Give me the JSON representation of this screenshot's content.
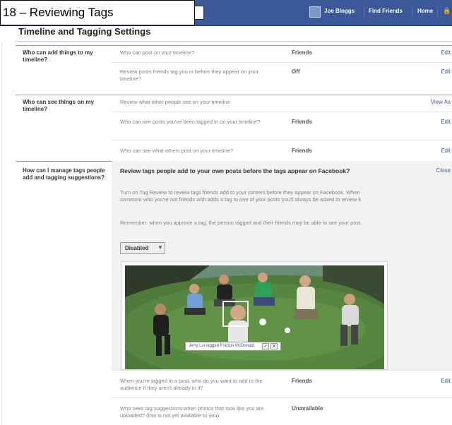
{
  "slide": {
    "title": "18 – Reviewing Tags"
  },
  "topbar": {
    "user_name": "Joe Bloggs",
    "nav_find_friends": "Find Friends",
    "nav_home": "Home",
    "bar_color": "#3b5998"
  },
  "page": {
    "heading": "Timeline and Tagging Settings"
  },
  "sections": {
    "add_things": {
      "label": "Who can add things to my timeline?",
      "rows": [
        {
          "question": "Who can post on your timeline?",
          "value": "Friends",
          "action": "Edit"
        },
        {
          "question": "Review posts friends tag you in before they appear on your timeline?",
          "value": "Off",
          "action": "Edit"
        }
      ]
    },
    "see_things": {
      "label": "Who can see things on my timeline?",
      "rows": [
        {
          "question": "Review what other people see on your timeline",
          "value": "",
          "action": "View As"
        },
        {
          "question": "Who can see posts you've been tagged in on your timeline?",
          "value": "Friends",
          "action": "Edit"
        },
        {
          "question": "Who can see what others post on your timeline?",
          "value": "Friends",
          "action": "Edit"
        }
      ]
    },
    "manage_tags": {
      "label": "How can I manage tags people add and tagging suggestions?",
      "review": {
        "title": "Review tags people add to your own posts before the tags appear on Facebook?",
        "close": "Close",
        "description": "Turn on Tag Review to review tags friends add to your content before they appear on Facebook. When someone who you're not friends with adds a tag to one of your posts you'll always be asked to review it.",
        "remember": "Remember: when you approve a tag, the person tagged and their friends may be able to see your post.",
        "dropdown_value": "Disabled",
        "tag_popup": {
          "tagger": "Jerry Lui",
          "verb": "tagged",
          "tagged": "Francis McDonald.",
          "approve": "✓",
          "reject": "✕"
        }
      },
      "rows": [
        {
          "question": "When you're tagged in a post, who do you want to add to the audience if they aren't already in it?",
          "value": "Friends",
          "action": "Edit"
        },
        {
          "question": "Who sees tag suggestions when photos that look like you are uploaded? (this is not yet available to you)",
          "value": "Unavailable",
          "action": ""
        }
      ]
    }
  }
}
